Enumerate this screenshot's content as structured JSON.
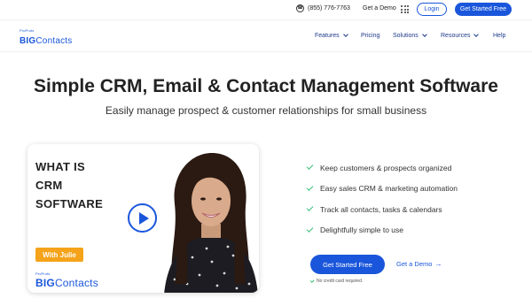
{
  "topbar": {
    "phone": "(855) 776-7763",
    "demo_link": "Get a Demo",
    "login": "Login",
    "get_started": "Get Started Free"
  },
  "logo": {
    "small": "ProProfs",
    "main_bold": "BIG",
    "main_rest": "Contacts"
  },
  "nav": {
    "items": [
      {
        "label": "Features",
        "dropdown": true
      },
      {
        "label": "Pricing",
        "dropdown": false
      },
      {
        "label": "Solutions",
        "dropdown": true
      },
      {
        "label": "Resources",
        "dropdown": true
      },
      {
        "label": "Help",
        "dropdown": false
      }
    ]
  },
  "hero": {
    "headline": "Simple CRM, Email & Contact Management Software",
    "subheadline": "Easily manage prospect & customer relationships for small business"
  },
  "video": {
    "title_lines": [
      "WHAT IS",
      "CRM",
      "SOFTWARE"
    ],
    "badge": "With Julie",
    "logo_small": "ProProfs",
    "logo_bold": "BIG",
    "logo_rest": "Contacts"
  },
  "features": [
    "Keep customers & prospects organized",
    "Easy sales CRM & marketing automation",
    "Track all contacts, tasks & calendars",
    "Delightfully simple to use"
  ],
  "cta": {
    "primary": "Get Started Free",
    "secondary": "Get a Demo",
    "note": "No credit card required."
  },
  "colors": {
    "brand_blue": "#1a56db",
    "check_green": "#3bbf7a",
    "badge_orange": "#f5a31a"
  }
}
